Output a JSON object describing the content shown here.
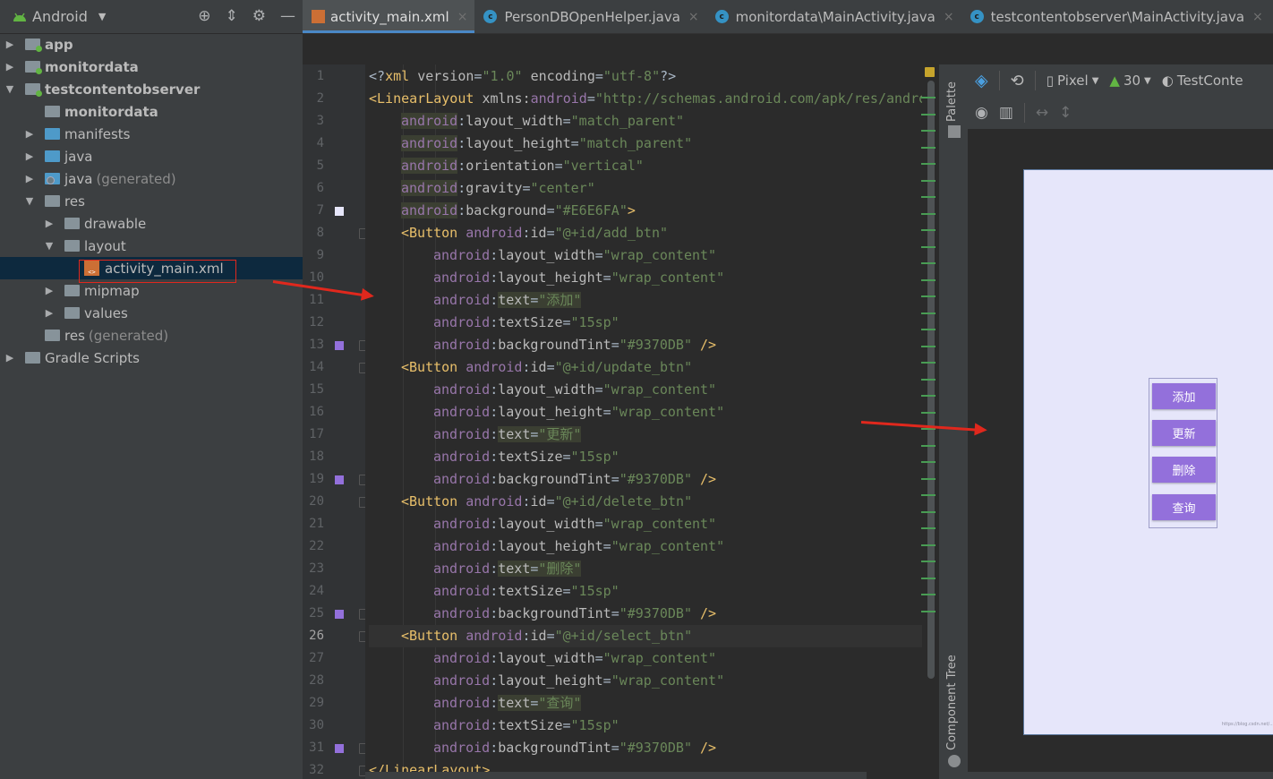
{
  "project": {
    "view_label": "Android",
    "tree": [
      {
        "label": "app",
        "indent": 0,
        "arrow": "▶",
        "icon": "folder-module-icon",
        "color": "grey",
        "bold": true,
        "dot": true
      },
      {
        "label": "monitordata",
        "indent": 0,
        "arrow": "▶",
        "icon": "folder-module-icon",
        "color": "grey",
        "bold": true,
        "dot": true
      },
      {
        "label": "testcontentobserver",
        "indent": 0,
        "arrow": "▼",
        "icon": "folder-module-icon",
        "color": "grey",
        "bold": true,
        "dot": true
      },
      {
        "label": "monitordata",
        "indent": 1,
        "arrow": "",
        "icon": "folder-module-icon",
        "color": "grey",
        "bold": true,
        "dot": false
      },
      {
        "label": "manifests",
        "indent": 1,
        "arrow": "▶",
        "icon": "folder-icon",
        "color": "blue",
        "bold": false,
        "dot": false
      },
      {
        "label": "java",
        "indent": 1,
        "arrow": "▶",
        "icon": "folder-icon",
        "color": "blue",
        "bold": false,
        "dot": false
      },
      {
        "label": "java",
        "suffix": "(generated)",
        "indent": 1,
        "arrow": "▶",
        "icon": "folder-generated-icon",
        "color": "blue",
        "bold": false,
        "dot": false
      },
      {
        "label": "res",
        "indent": 1,
        "arrow": "▼",
        "icon": "folder-resources-icon",
        "color": "grey",
        "bold": false,
        "dot": false
      },
      {
        "label": "drawable",
        "indent": 2,
        "arrow": "▶",
        "icon": "folder-icon",
        "color": "grey",
        "bold": false,
        "dot": false
      },
      {
        "label": "layout",
        "indent": 2,
        "arrow": "▼",
        "icon": "folder-icon",
        "color": "grey",
        "bold": false,
        "dot": false
      },
      {
        "label": "activity_main.xml",
        "indent": 3,
        "arrow": "",
        "icon": "xml-file-icon",
        "color": "",
        "bold": false,
        "dot": false,
        "selected": true
      },
      {
        "label": "mipmap",
        "indent": 2,
        "arrow": "▶",
        "icon": "folder-icon",
        "color": "grey",
        "bold": false,
        "dot": false
      },
      {
        "label": "values",
        "indent": 2,
        "arrow": "▶",
        "icon": "folder-icon",
        "color": "grey",
        "bold": false,
        "dot": false
      },
      {
        "label": "res",
        "suffix": "(generated)",
        "indent": 1,
        "arrow": "",
        "icon": "folder-resources-icon",
        "color": "grey",
        "bold": false,
        "dot": false
      },
      {
        "label": "Gradle Scripts",
        "indent": 0,
        "arrow": "▶",
        "icon": "gradle-icon",
        "color": "grey",
        "bold": false,
        "dot": false
      }
    ]
  },
  "tabs": [
    {
      "label": "activity_main.xml",
      "icon": "xml-file-icon",
      "active": true
    },
    {
      "label": "PersonDBOpenHelper.java",
      "icon": "class-icon",
      "active": false
    },
    {
      "label": "monitordata\\MainActivity.java",
      "icon": "class-icon",
      "active": false
    },
    {
      "label": "testcontentobserver\\MainActivity.java",
      "icon": "class-icon",
      "active": false
    }
  ],
  "editor": {
    "current_line": 26,
    "lines": [
      {
        "n": 1,
        "indent": 0,
        "tokens": [
          [
            "p",
            "<?"
          ],
          [
            "tag",
            "xml "
          ],
          [
            "attr",
            "version"
          ],
          [
            "p",
            "="
          ],
          [
            "val",
            "\"1.0\""
          ],
          [
            "attr",
            " encoding"
          ],
          [
            "p",
            "="
          ],
          [
            "val",
            "\"utf-8\""
          ],
          [
            "p",
            "?>"
          ]
        ]
      },
      {
        "n": 2,
        "indent": 0,
        "tokens": [
          [
            "tag",
            "<LinearLayout "
          ],
          [
            "attr",
            "xmlns:"
          ],
          [
            "ns",
            "android"
          ],
          [
            "p",
            "="
          ],
          [
            "val",
            "\"http://schemas.android.com/apk/res/android\""
          ]
        ]
      },
      {
        "n": 3,
        "indent": 1,
        "tokens": [
          [
            "ns",
            "android"
          ],
          [
            "p",
            ":"
          ],
          [
            "attr",
            "layout_width"
          ],
          [
            "p",
            "="
          ],
          [
            "val",
            "\"match_parent\""
          ]
        ]
      },
      {
        "n": 4,
        "indent": 1,
        "tokens": [
          [
            "ns",
            "android"
          ],
          [
            "p",
            ":"
          ],
          [
            "attr",
            "layout_height"
          ],
          [
            "p",
            "="
          ],
          [
            "val",
            "\"match_parent\""
          ]
        ]
      },
      {
        "n": 5,
        "indent": 1,
        "tokens": [
          [
            "ns",
            "android"
          ],
          [
            "p",
            ":"
          ],
          [
            "attr",
            "orientation"
          ],
          [
            "p",
            "="
          ],
          [
            "val",
            "\"vertical\""
          ]
        ]
      },
      {
        "n": 6,
        "indent": 1,
        "tokens": [
          [
            "ns",
            "android"
          ],
          [
            "p",
            ":"
          ],
          [
            "attr",
            "gravity"
          ],
          [
            "p",
            "="
          ],
          [
            "val",
            "\"center\""
          ]
        ]
      },
      {
        "n": 7,
        "indent": 1,
        "mark": "#E6E6FA",
        "tokens": [
          [
            "ns",
            "android"
          ],
          [
            "p",
            ":"
          ],
          [
            "attr",
            "background"
          ],
          [
            "p",
            "="
          ],
          [
            "val",
            "\"#E6E6FA\""
          ],
          [
            "tag",
            ">"
          ]
        ]
      },
      {
        "n": 8,
        "indent": 1,
        "fold": true,
        "tokens": [
          [
            "tag",
            "<Button "
          ],
          [
            "ns",
            "android"
          ],
          [
            "p",
            ":"
          ],
          [
            "attr",
            "id"
          ],
          [
            "p",
            "="
          ],
          [
            "val",
            "\"@+id/add_btn\""
          ]
        ]
      },
      {
        "n": 9,
        "indent": 2,
        "tokens": [
          [
            "ns",
            "android"
          ],
          [
            "p",
            ":"
          ],
          [
            "attr",
            "layout_width"
          ],
          [
            "p",
            "="
          ],
          [
            "val",
            "\"wrap_content\""
          ]
        ]
      },
      {
        "n": 10,
        "indent": 2,
        "tokens": [
          [
            "ns",
            "android"
          ],
          [
            "p",
            ":"
          ],
          [
            "attr",
            "layout_height"
          ],
          [
            "p",
            "="
          ],
          [
            "val",
            "\"wrap_content\""
          ]
        ]
      },
      {
        "n": 11,
        "indent": 2,
        "hl": true,
        "tokens": [
          [
            "ns",
            "android"
          ],
          [
            "p",
            ":"
          ],
          [
            "attr",
            "text"
          ],
          [
            "p",
            "="
          ],
          [
            "val",
            "\"添加\""
          ]
        ]
      },
      {
        "n": 12,
        "indent": 2,
        "tokens": [
          [
            "ns",
            "android"
          ],
          [
            "p",
            ":"
          ],
          [
            "attr",
            "textSize"
          ],
          [
            "p",
            "="
          ],
          [
            "val",
            "\"15sp\""
          ]
        ]
      },
      {
        "n": 13,
        "indent": 2,
        "mark": "#9370DB",
        "fold": true,
        "tokens": [
          [
            "ns",
            "android"
          ],
          [
            "p",
            ":"
          ],
          [
            "attr",
            "backgroundTint"
          ],
          [
            "p",
            "="
          ],
          [
            "val",
            "\"#9370DB\""
          ],
          [
            "tag",
            " />"
          ]
        ]
      },
      {
        "n": 14,
        "indent": 1,
        "fold": true,
        "tokens": [
          [
            "tag",
            "<Button "
          ],
          [
            "ns",
            "android"
          ],
          [
            "p",
            ":"
          ],
          [
            "attr",
            "id"
          ],
          [
            "p",
            "="
          ],
          [
            "val",
            "\"@+id/update_btn\""
          ]
        ]
      },
      {
        "n": 15,
        "indent": 2,
        "tokens": [
          [
            "ns",
            "android"
          ],
          [
            "p",
            ":"
          ],
          [
            "attr",
            "layout_width"
          ],
          [
            "p",
            "="
          ],
          [
            "val",
            "\"wrap_content\""
          ]
        ]
      },
      {
        "n": 16,
        "indent": 2,
        "tokens": [
          [
            "ns",
            "android"
          ],
          [
            "p",
            ":"
          ],
          [
            "attr",
            "layout_height"
          ],
          [
            "p",
            "="
          ],
          [
            "val",
            "\"wrap_content\""
          ]
        ]
      },
      {
        "n": 17,
        "indent": 2,
        "hl": true,
        "tokens": [
          [
            "ns",
            "android"
          ],
          [
            "p",
            ":"
          ],
          [
            "attr",
            "text"
          ],
          [
            "p",
            "="
          ],
          [
            "val",
            "\"更新\""
          ]
        ]
      },
      {
        "n": 18,
        "indent": 2,
        "tokens": [
          [
            "ns",
            "android"
          ],
          [
            "p",
            ":"
          ],
          [
            "attr",
            "textSize"
          ],
          [
            "p",
            "="
          ],
          [
            "val",
            "\"15sp\""
          ]
        ]
      },
      {
        "n": 19,
        "indent": 2,
        "mark": "#9370DB",
        "fold": true,
        "tokens": [
          [
            "ns",
            "android"
          ],
          [
            "p",
            ":"
          ],
          [
            "attr",
            "backgroundTint"
          ],
          [
            "p",
            "="
          ],
          [
            "val",
            "\"#9370DB\""
          ],
          [
            "tag",
            " />"
          ]
        ]
      },
      {
        "n": 20,
        "indent": 1,
        "fold": true,
        "tokens": [
          [
            "tag",
            "<Button "
          ],
          [
            "ns",
            "android"
          ],
          [
            "p",
            ":"
          ],
          [
            "attr",
            "id"
          ],
          [
            "p",
            "="
          ],
          [
            "val",
            "\"@+id/delete_btn\""
          ]
        ]
      },
      {
        "n": 21,
        "indent": 2,
        "tokens": [
          [
            "ns",
            "android"
          ],
          [
            "p",
            ":"
          ],
          [
            "attr",
            "layout_width"
          ],
          [
            "p",
            "="
          ],
          [
            "val",
            "\"wrap_content\""
          ]
        ]
      },
      {
        "n": 22,
        "indent": 2,
        "tokens": [
          [
            "ns",
            "android"
          ],
          [
            "p",
            ":"
          ],
          [
            "attr",
            "layout_height"
          ],
          [
            "p",
            "="
          ],
          [
            "val",
            "\"wrap_content\""
          ]
        ]
      },
      {
        "n": 23,
        "indent": 2,
        "hl": true,
        "tokens": [
          [
            "ns",
            "android"
          ],
          [
            "p",
            ":"
          ],
          [
            "attr",
            "text"
          ],
          [
            "p",
            "="
          ],
          [
            "val",
            "\"删除\""
          ]
        ]
      },
      {
        "n": 24,
        "indent": 2,
        "tokens": [
          [
            "ns",
            "android"
          ],
          [
            "p",
            ":"
          ],
          [
            "attr",
            "textSize"
          ],
          [
            "p",
            "="
          ],
          [
            "val",
            "\"15sp\""
          ]
        ]
      },
      {
        "n": 25,
        "indent": 2,
        "mark": "#9370DB",
        "fold": true,
        "tokens": [
          [
            "ns",
            "android"
          ],
          [
            "p",
            ":"
          ],
          [
            "attr",
            "backgroundTint"
          ],
          [
            "p",
            "="
          ],
          [
            "val",
            "\"#9370DB\""
          ],
          [
            "tag",
            " />"
          ]
        ]
      },
      {
        "n": 26,
        "indent": 1,
        "fold": true,
        "tokens": [
          [
            "tag",
            "<Button "
          ],
          [
            "ns",
            "android"
          ],
          [
            "p",
            ":"
          ],
          [
            "attr",
            "id"
          ],
          [
            "p",
            "="
          ],
          [
            "val",
            "\"@+id/select_btn\""
          ]
        ]
      },
      {
        "n": 27,
        "indent": 2,
        "tokens": [
          [
            "ns",
            "android"
          ],
          [
            "p",
            ":"
          ],
          [
            "attr",
            "layout_width"
          ],
          [
            "p",
            "="
          ],
          [
            "val",
            "\"wrap_content\""
          ]
        ]
      },
      {
        "n": 28,
        "indent": 2,
        "tokens": [
          [
            "ns",
            "android"
          ],
          [
            "p",
            ":"
          ],
          [
            "attr",
            "layout_height"
          ],
          [
            "p",
            "="
          ],
          [
            "val",
            "\"wrap_content\""
          ]
        ]
      },
      {
        "n": 29,
        "indent": 2,
        "hl": true,
        "tokens": [
          [
            "ns",
            "android"
          ],
          [
            "p",
            ":"
          ],
          [
            "attr",
            "text"
          ],
          [
            "p",
            "="
          ],
          [
            "val",
            "\"查询\""
          ]
        ]
      },
      {
        "n": 30,
        "indent": 2,
        "tokens": [
          [
            "ns",
            "android"
          ],
          [
            "p",
            ":"
          ],
          [
            "attr",
            "textSize"
          ],
          [
            "p",
            "="
          ],
          [
            "val",
            "\"15sp\""
          ]
        ]
      },
      {
        "n": 31,
        "indent": 2,
        "mark": "#9370DB",
        "fold": true,
        "tokens": [
          [
            "ns",
            "android"
          ],
          [
            "p",
            ":"
          ],
          [
            "attr",
            "backgroundTint"
          ],
          [
            "p",
            "="
          ],
          [
            "val",
            "\"#9370DB\""
          ],
          [
            "tag",
            " />"
          ]
        ]
      },
      {
        "n": 32,
        "indent": 0,
        "fold": true,
        "tokens": [
          [
            "tag",
            "</LinearLayout>"
          ]
        ]
      }
    ]
  },
  "side_tabs": {
    "palette": "Palette",
    "component_tree": "Component Tree"
  },
  "design_toolbar": {
    "device": "Pixel",
    "api": "30",
    "theme": "TestConte"
  },
  "preview": {
    "background": "#E6E6FA",
    "button_color": "#9370DB",
    "buttons": [
      "添加",
      "更新",
      "删除",
      "查询"
    ]
  }
}
